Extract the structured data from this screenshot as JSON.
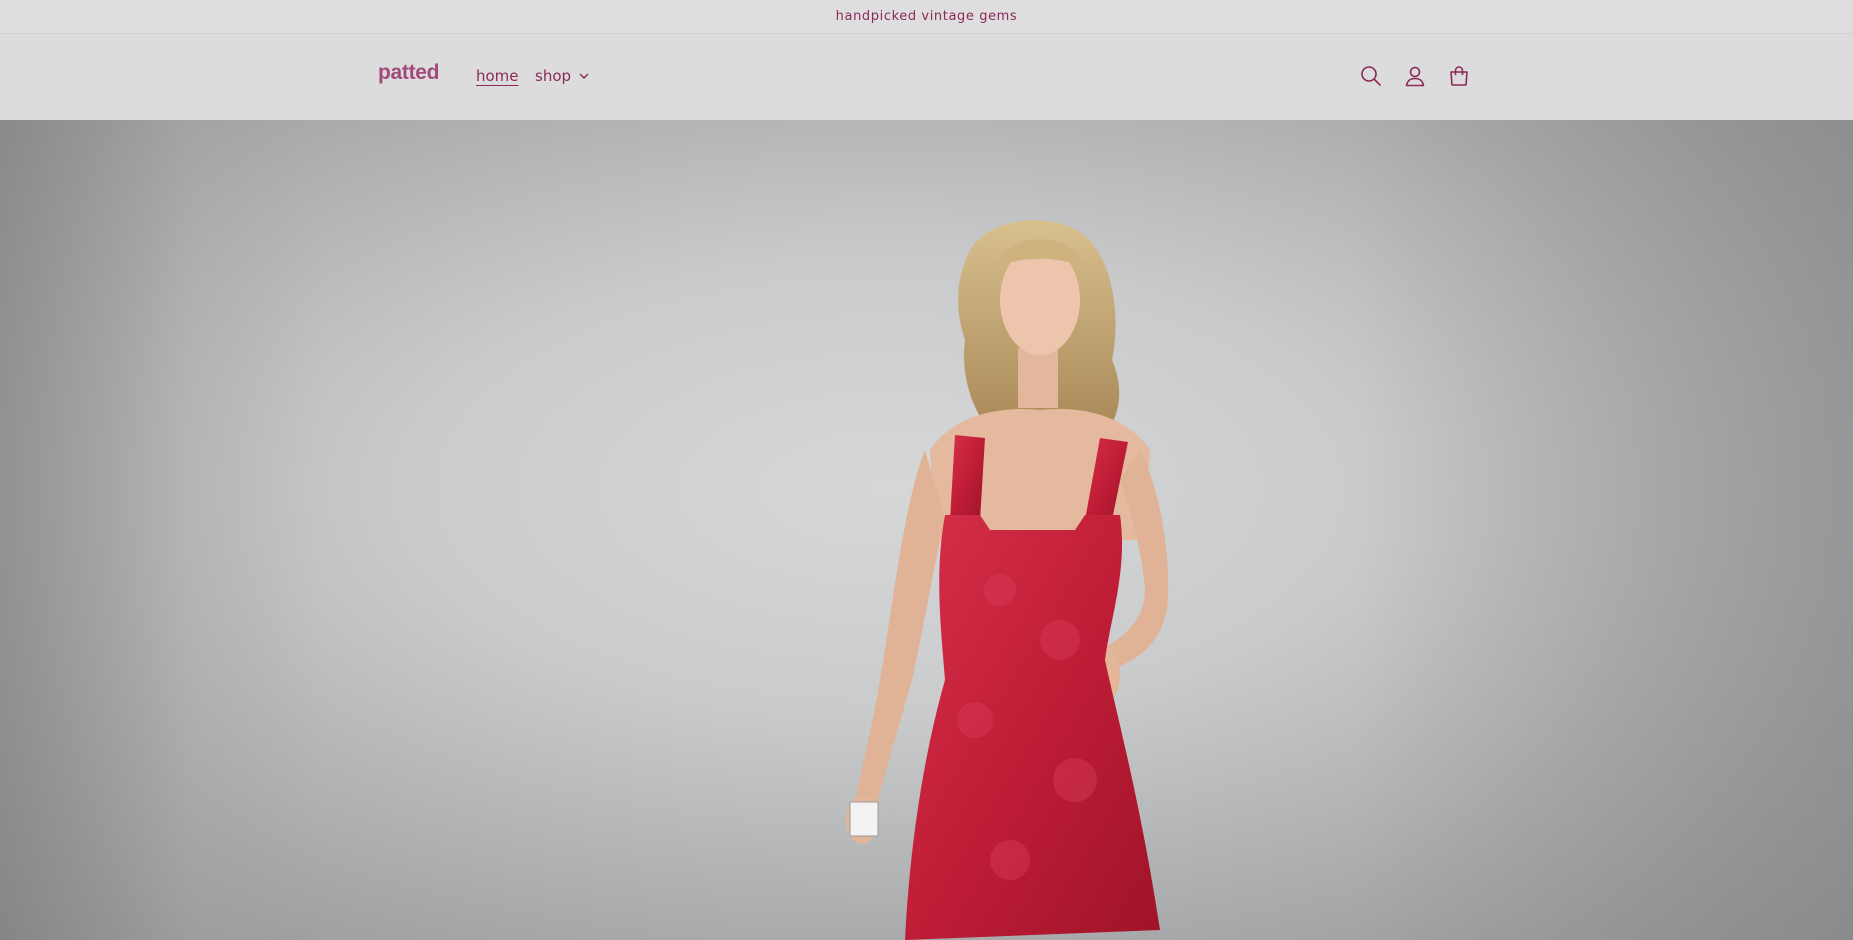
{
  "announcement": {
    "text": "handpicked vintage gems"
  },
  "header": {
    "logo_text": "patted",
    "nav": {
      "home_label": "home",
      "shop_label": "shop"
    },
    "icons": {
      "search": "search-icon",
      "account": "account-icon",
      "cart": "cart-icon"
    }
  },
  "hero": {
    "image": "model-in-red-satin-romper",
    "dress_color": "#c81e3a",
    "backdrop_color": "#c8cacb"
  },
  "colors": {
    "accent": "#8b2a5a",
    "logo": "#a24a7c",
    "header_bg": "#dcdcdc"
  }
}
